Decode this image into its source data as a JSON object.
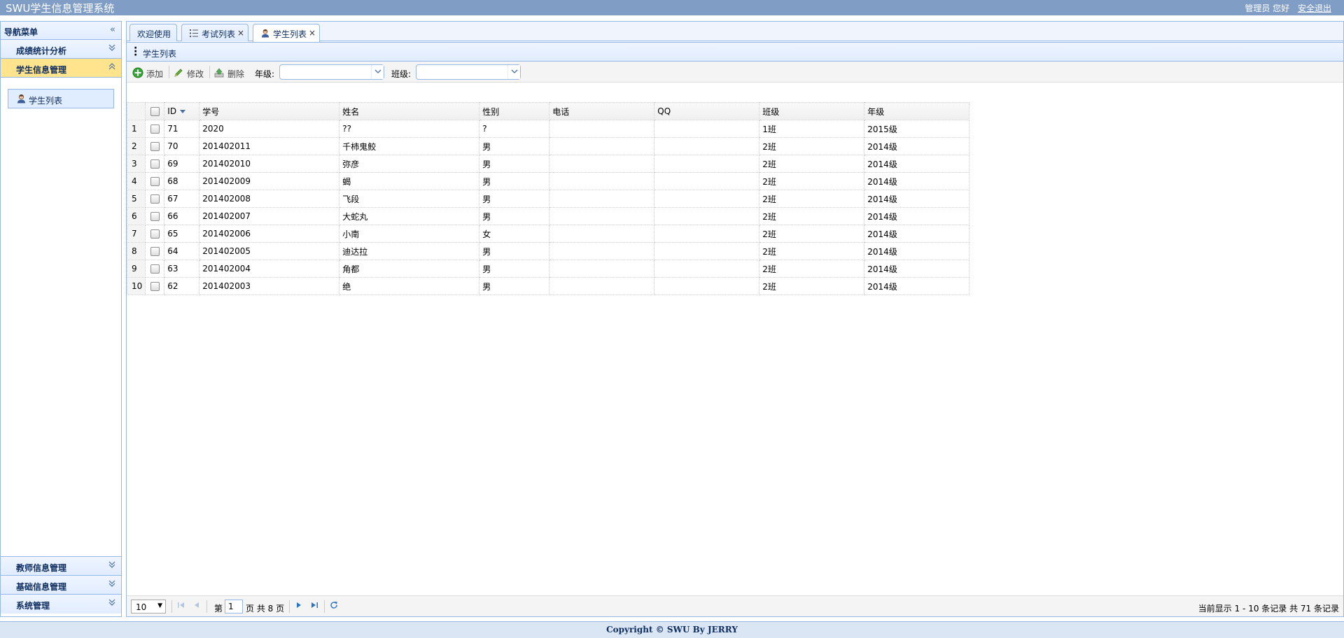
{
  "header": {
    "title": "SWU学生信息管理系统",
    "greeting": "管理员 您好",
    "logout": "安全退出"
  },
  "nav": {
    "title": "导航菜单",
    "collapse_icon": "double-chevron-left",
    "sections": [
      {
        "label": "成绩统计分析",
        "state": "collapsed"
      },
      {
        "label": "学生信息管理",
        "state": "expanded"
      },
      {
        "label": "教师信息管理",
        "state": "collapsed"
      },
      {
        "label": "基础信息管理",
        "state": "collapsed"
      },
      {
        "label": "系统管理",
        "state": "collapsed"
      }
    ],
    "active_item": "学生列表"
  },
  "tabs": [
    {
      "label": "欢迎使用",
      "closable": false
    },
    {
      "label": "考试列表",
      "closable": true,
      "icon": "list-icon"
    },
    {
      "label": "学生列表",
      "closable": true,
      "icon": "student-icon",
      "selected": true
    }
  ],
  "panel": {
    "title": "学生列表"
  },
  "toolbar": {
    "add": "添加",
    "edit": "修改",
    "delete": "删除",
    "grade_label": "年级:",
    "class_label": "班级:",
    "grade_value": "",
    "class_value": ""
  },
  "grid": {
    "columns": [
      "ID",
      "学号",
      "姓名",
      "性别",
      "电话",
      "QQ",
      "班级",
      "年级"
    ],
    "sorted_column": "ID",
    "rows": [
      {
        "n": "1",
        "id": "71",
        "sno": "2020",
        "name": "??",
        "sex": "?",
        "phone": "",
        "qq": "",
        "cls": "1班",
        "grade": "2015级"
      },
      {
        "n": "2",
        "id": "70",
        "sno": "201402011",
        "name": "千柿鬼鲛",
        "sex": "男",
        "phone": "",
        "qq": "",
        "cls": "2班",
        "grade": "2014级"
      },
      {
        "n": "3",
        "id": "69",
        "sno": "201402010",
        "name": "弥彦",
        "sex": "男",
        "phone": "",
        "qq": "",
        "cls": "2班",
        "grade": "2014级"
      },
      {
        "n": "4",
        "id": "68",
        "sno": "201402009",
        "name": "蝎",
        "sex": "男",
        "phone": "",
        "qq": "",
        "cls": "2班",
        "grade": "2014级"
      },
      {
        "n": "5",
        "id": "67",
        "sno": "201402008",
        "name": "飞段",
        "sex": "男",
        "phone": "",
        "qq": "",
        "cls": "2班",
        "grade": "2014级"
      },
      {
        "n": "6",
        "id": "66",
        "sno": "201402007",
        "name": "大蛇丸",
        "sex": "男",
        "phone": "",
        "qq": "",
        "cls": "2班",
        "grade": "2014级"
      },
      {
        "n": "7",
        "id": "65",
        "sno": "201402006",
        "name": "小南",
        "sex": "女",
        "phone": "",
        "qq": "",
        "cls": "2班",
        "grade": "2014级"
      },
      {
        "n": "8",
        "id": "64",
        "sno": "201402005",
        "name": "迪达拉",
        "sex": "男",
        "phone": "",
        "qq": "",
        "cls": "2班",
        "grade": "2014级"
      },
      {
        "n": "9",
        "id": "63",
        "sno": "201402004",
        "name": "角都",
        "sex": "男",
        "phone": "",
        "qq": "",
        "cls": "2班",
        "grade": "2014级"
      },
      {
        "n": "10",
        "id": "62",
        "sno": "201402003",
        "name": "绝",
        "sex": "男",
        "phone": "",
        "qq": "",
        "cls": "2班",
        "grade": "2014级"
      }
    ]
  },
  "pager": {
    "page_size": "10",
    "page_prefix": "第",
    "page_value": "1",
    "page_suffix": "页 共 8 页",
    "info": "当前显示 1 - 10 条记录 共 71 条记录"
  },
  "footer": {
    "text": "Copyright © SWU By JERRY"
  },
  "colors": {
    "header_bg": "#7f9dc5",
    "border": "#95b8e7",
    "active_section": "#ffe48d",
    "footer_bg": "#dbe6f5"
  }
}
